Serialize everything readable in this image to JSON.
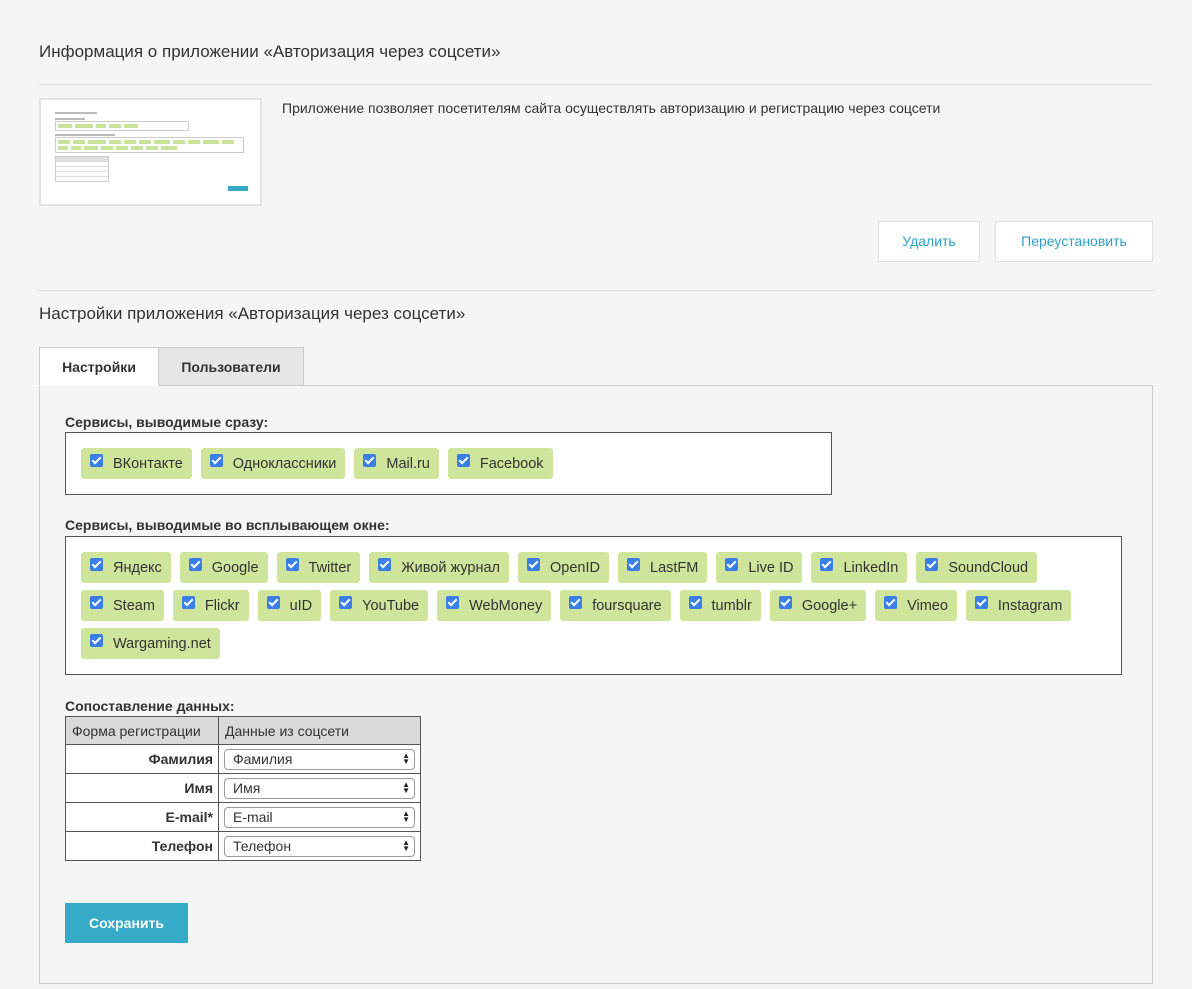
{
  "info_section": {
    "title": "Информация о приложении «Авторизация через соцсети»",
    "description": "Приложение позволяет посетителям сайта осуществлять авторизацию и регистрацию через соцсети",
    "remove_label": "Удалить",
    "reinstall_label": "Переустановить"
  },
  "settings_section": {
    "title": "Настройки приложения «Авторизация через соцсети»",
    "tabs": [
      {
        "label": "Настройки",
        "active": true
      },
      {
        "label": "Пользователи",
        "active": false
      }
    ]
  },
  "services_direct": {
    "label": "Сервисы, выводимые сразу:",
    "items": [
      "ВКонтакте",
      "Одноклассники",
      "Mail.ru",
      "Facebook"
    ]
  },
  "services_popup": {
    "label": "Сервисы, выводимые во всплывающем окне:",
    "items": [
      "Яндекс",
      "Google",
      "Twitter",
      "Живой журнал",
      "OpenID",
      "LastFM",
      "Live ID",
      "LinkedIn",
      "SoundCloud",
      "Steam",
      "Flickr",
      "uID",
      "YouTube",
      "WebMoney",
      "foursquare",
      "tumblr",
      "Google+",
      "Vimeo",
      "Instagram",
      "Wargaming.net"
    ]
  },
  "mapping": {
    "label": "Сопоставление данных:",
    "headers": [
      "Форма регистрации",
      "Данные из соцсети"
    ],
    "rows": [
      {
        "field": "Фамилия",
        "value": "Фамилия"
      },
      {
        "field": "Имя",
        "value": "Имя"
      },
      {
        "field": "E-mail*",
        "value": "E-mail"
      },
      {
        "field": "Телефон",
        "value": "Телефон"
      }
    ]
  },
  "save_label": "Сохранить",
  "colors": {
    "accent": "#36abc7",
    "chip": "#cfe59c",
    "checkbox": "#3a7ee8",
    "link": "#2f9fc4"
  }
}
